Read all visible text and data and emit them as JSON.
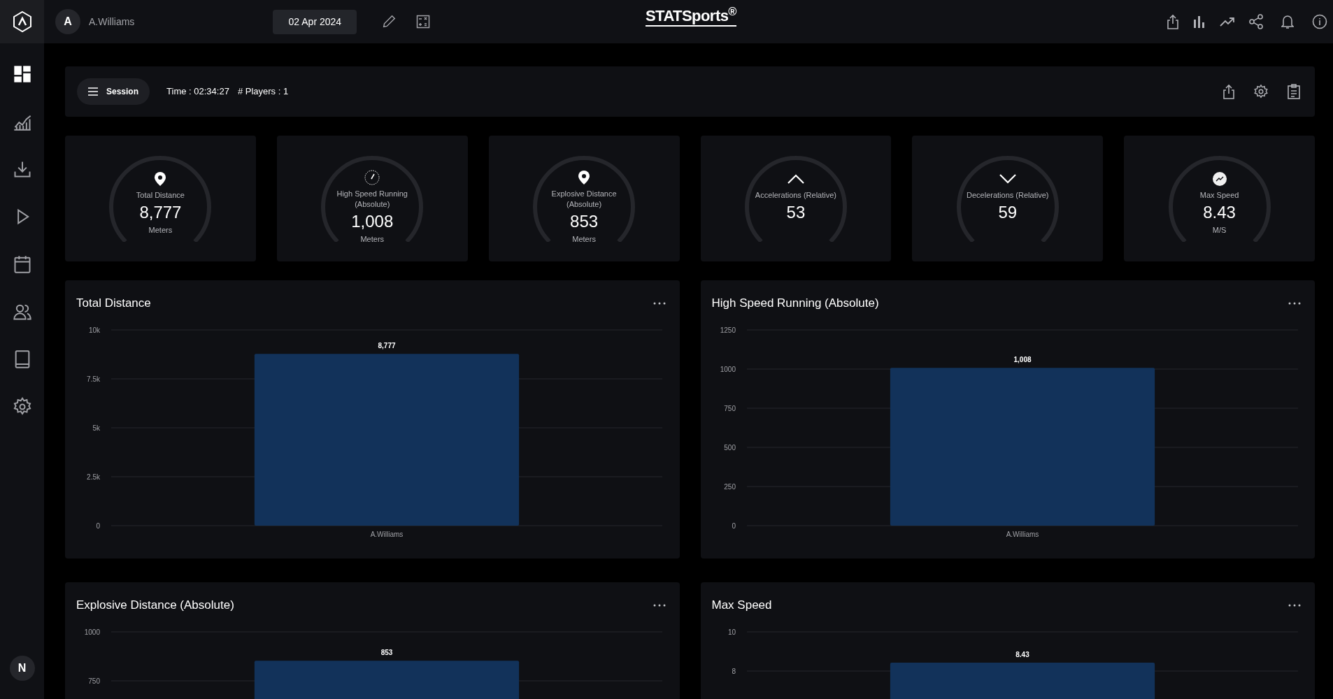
{
  "header": {
    "avatar": "A",
    "user": "A.Williams",
    "date": "02 Apr 2024",
    "brand": "STATSports$^{®}$"
  },
  "sidebar": {
    "items": [
      {
        "kind": "dashboard",
        "selected": true
      },
      {
        "kind": "analysis",
        "selected": false
      },
      {
        "kind": "download",
        "selected": false
      },
      {
        "kind": "play",
        "selected": false
      },
      {
        "kind": "calendar",
        "selected": false
      },
      {
        "kind": "people",
        "selected": false
      },
      {
        "kind": "tablet",
        "selected": false
      },
      {
        "kind": "settings",
        "selected": false
      }
    ],
    "account": "N"
  },
  "session_bar": {
    "button": "Session",
    "time": "Time : 02:34:27",
    "players": "# Players : 1"
  },
  "kpis": [
    {
      "kind": "pin",
      "label": "Total Distance",
      "value": "8,777",
      "unit": "Meters"
    },
    {
      "kind": "gauge",
      "label": "High Speed Running (Absolute)",
      "value": "1,008",
      "unit": "Meters"
    },
    {
      "kind": "pin",
      "label": "Explosive Distance (Absolute)",
      "value": "853",
      "unit": "Meters"
    },
    {
      "kind": "up",
      "label": "Accelerations (Relative)",
      "value": "53"
    },
    {
      "kind": "down",
      "label": "Decelerations (Relative)",
      "value": "59"
    },
    {
      "kind": "speed",
      "label": "Max Speed",
      "value": "8.43",
      "unit": "M/S"
    }
  ],
  "charts": [
    {
      "title": "Total Distance",
      "chart_data": {
        "type": "bar",
        "categories": [
          "A.Williams"
        ],
        "grid": true,
        "series": [
          {
            "color": "#12325a",
            "values": [
              8777
            ]
          }
        ],
        "ylim": [
          0,
          10000
        ],
        "yticks": [
          {
            "value": 0,
            "label": "0"
          },
          {
            "value": 2500,
            "label": "2.5k"
          },
          {
            "value": 5000,
            "label": "5k"
          },
          {
            "value": 7500,
            "label": "7.5k"
          },
          {
            "value": 10000,
            "label": "10k"
          }
        ],
        "value_labels": [
          "8,777"
        ]
      }
    },
    {
      "title": "High Speed Running (Absolute)",
      "chart_data": {
        "type": "bar",
        "categories": [
          "A.Williams"
        ],
        "grid": true,
        "series": [
          {
            "color": "#12325a",
            "values": [
              1008
            ]
          }
        ],
        "ylim": [
          0,
          1250
        ],
        "yticks": [
          0,
          250,
          500,
          750,
          1000,
          1250
        ],
        "value_labels": [
          "1,008"
        ]
      }
    },
    {
      "title": "Explosive Distance (Absolute)",
      "chart_data": {
        "type": "bar",
        "grid": true,
        "series": [
          {
            "color": "#12325a",
            "values": [
              853
            ]
          }
        ],
        "ylim": [
          0,
          1000
        ],
        "yticks": [
          750,
          1000
        ],
        "value_labels": [
          "853"
        ]
      }
    },
    {
      "title": "Max Speed",
      "chart_data": {
        "type": "bar",
        "grid": true,
        "series": [
          {
            "color": "#12325a",
            "values": [
              8.43
            ]
          }
        ],
        "ylim": [
          0,
          10
        ],
        "yticks": [
          8,
          10
        ],
        "value_labels": [
          "8.43"
        ]
      }
    }
  ]
}
